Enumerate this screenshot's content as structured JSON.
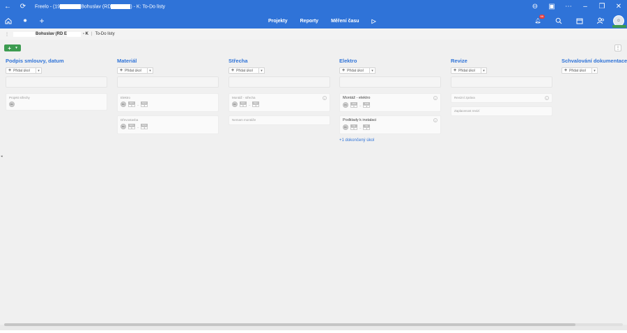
{
  "window": {
    "title_pre": "Freelo - (19",
    "title_mid": "Bohuslav (RD",
    "title_post": ") - K: To-Do listy"
  },
  "nav": {
    "projects": "Projekty",
    "reports": "Reporty",
    "time": "Měření času"
  },
  "notifications": {
    "count": "99"
  },
  "breadcrumb": {
    "project": "Bohuslav (RD E",
    "project_tail": "- K",
    "sep": "|",
    "page": "To-Do listy"
  },
  "add_button": {
    "plus": "+",
    "caret": "▾"
  },
  "columns": [
    {
      "title": "Podpis smlouvy, datum",
      "add_label": "Přidat úkol",
      "cards": [
        {
          "title": "Projekt střechy",
          "avatar": "BK"
        }
      ]
    },
    {
      "title": "Materiál",
      "add_label": "Přidat úkol",
      "cards": [
        {
          "title": "Elektro",
          "avatar": "BK",
          "d1": [
            "NOV",
            "1"
          ],
          "d2": [
            "NOV",
            "1"
          ]
        },
        {
          "title": "Dřevostavba",
          "avatar": "BK",
          "d1": [
            "NOV",
            "1"
          ],
          "d2": [
            "NOV",
            "1"
          ]
        }
      ]
    },
    {
      "title": "Střecha",
      "add_label": "Přidat úkol",
      "cards": [
        {
          "title": "Montáž - střecha",
          "avatar": "BK",
          "d1": [
            "NOV",
            "1"
          ],
          "d2": [
            "DEC",
            "1"
          ]
        },
        {
          "title": "Nemam montáže"
        }
      ]
    },
    {
      "title": "Elektro",
      "add_label": "Přidat úkol",
      "cards": [
        {
          "title": "Montáž - elektro",
          "avatar": "PK",
          "d1": [
            "JAN",
            "1"
          ],
          "d2": [
            "JAN",
            "1"
          ]
        },
        {
          "title": "Podklady k instalaci",
          "avatar": "BK",
          "d1": [
            "FE",
            "1"
          ],
          "d2": [
            "FE",
            "1"
          ]
        }
      ],
      "done_link": "+1 dokončený úkol"
    },
    {
      "title": "Revize",
      "add_label": "Přidat úkol",
      "cards": [
        {
          "title": "Revizní zpráva"
        },
        {
          "title": "Zaplacenost revizí"
        }
      ]
    },
    {
      "title": "Schvalování dokumentace",
      "add_label": "Přidat úkol",
      "cards": []
    }
  ]
}
